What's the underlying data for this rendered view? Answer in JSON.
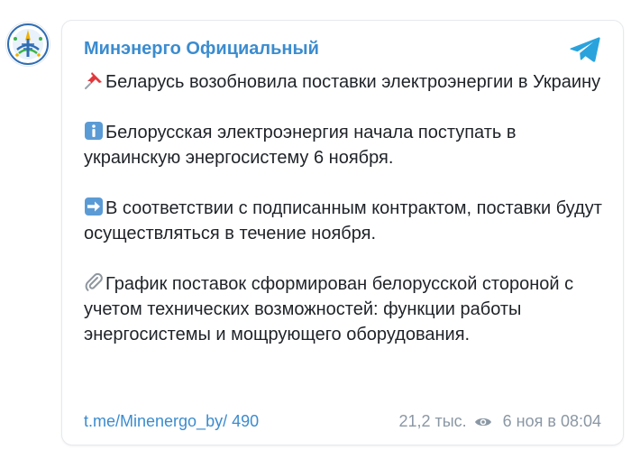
{
  "post": {
    "channel_name": "Минэнерго Официальный",
    "paragraphs": [
      {
        "emoji": "pushpin-icon",
        "text": "Беларусь возобновила поставки электроэнергии в Украину"
      },
      {
        "emoji": "information-icon",
        "text": "Белорусская электроэнергия начала поступать в украинскую энергосистему 6 ноября."
      },
      {
        "emoji": "right-arrow-icon",
        "text": "В соответствии с подписанным контрактом, поставки будут осуществляться в течение ноября."
      },
      {
        "emoji": "paperclip-icon",
        "text": "График поставок сформирован белорусской стороной с учетом технических возможностей: функции работы энергосистемы и мощрующего оборудования."
      }
    ],
    "link_text": "t.me/Minenergo_by/ 490",
    "views": "21,2 тыс.",
    "date": "6 ноя в 08:04"
  },
  "colors": {
    "accent": "#3b8ccf",
    "text": "#1f2328",
    "meta": "#8a97a4",
    "telegram": "#2aa3dd"
  }
}
